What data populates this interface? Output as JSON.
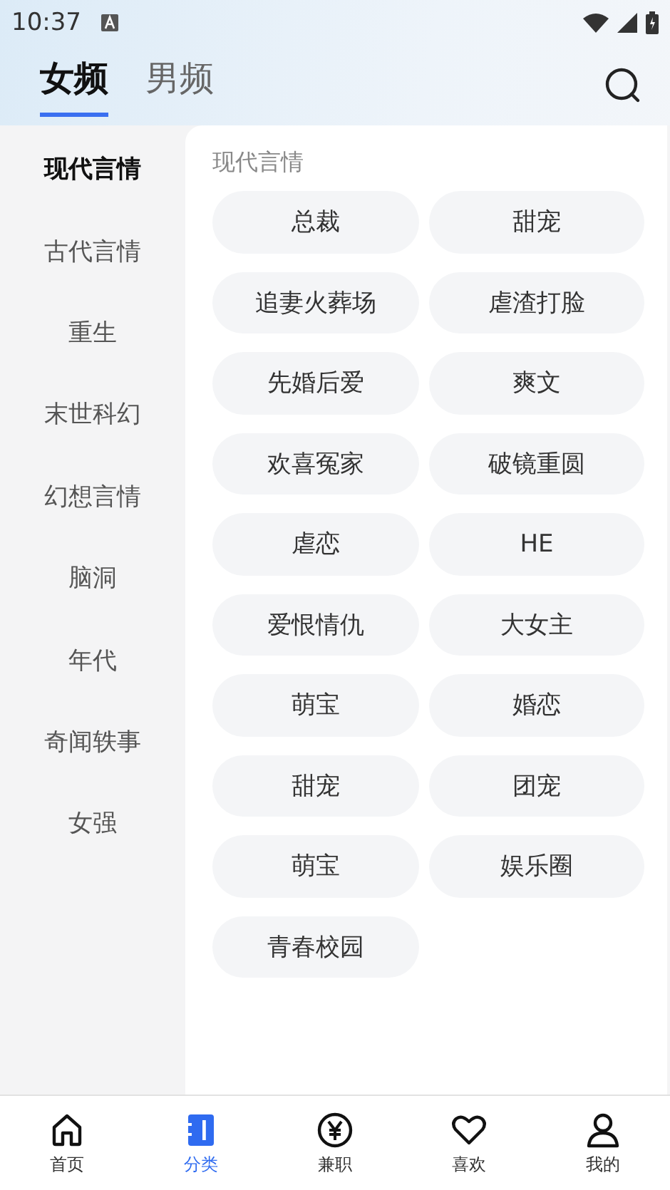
{
  "status_bar": {
    "time": "10:37"
  },
  "tabs": [
    {
      "label": "女频",
      "selected": true
    },
    {
      "label": "男频",
      "selected": false
    }
  ],
  "sidebar": {
    "items": [
      {
        "label": "现代言情",
        "selected": true
      },
      {
        "label": "古代言情",
        "selected": false
      },
      {
        "label": "重生",
        "selected": false
      },
      {
        "label": "末世科幻",
        "selected": false
      },
      {
        "label": "幻想言情",
        "selected": false
      },
      {
        "label": "脑洞",
        "selected": false
      },
      {
        "label": "年代",
        "selected": false
      },
      {
        "label": "奇闻轶事",
        "selected": false
      },
      {
        "label": "女强",
        "selected": false
      }
    ]
  },
  "content": {
    "heading": "现代言情",
    "tags": [
      "总裁",
      "甜宠",
      "追妻火葬场",
      "虐渣打脸",
      "先婚后爱",
      "爽文",
      "欢喜冤家",
      "破镜重圆",
      "虐恋",
      "HE",
      "爱恨情仇",
      "大女主",
      "萌宝",
      "婚恋",
      "甜宠",
      "团宠",
      "萌宝",
      "娱乐圈",
      "青春校园"
    ]
  },
  "bottom_nav": [
    {
      "kind": "home",
      "label": "首页",
      "selected": false
    },
    {
      "kind": "category",
      "label": "分类",
      "selected": true
    },
    {
      "kind": "money",
      "label": "兼职",
      "selected": false
    },
    {
      "kind": "heart",
      "label": "喜欢",
      "selected": false
    },
    {
      "kind": "person",
      "label": "我的",
      "selected": false
    }
  ]
}
